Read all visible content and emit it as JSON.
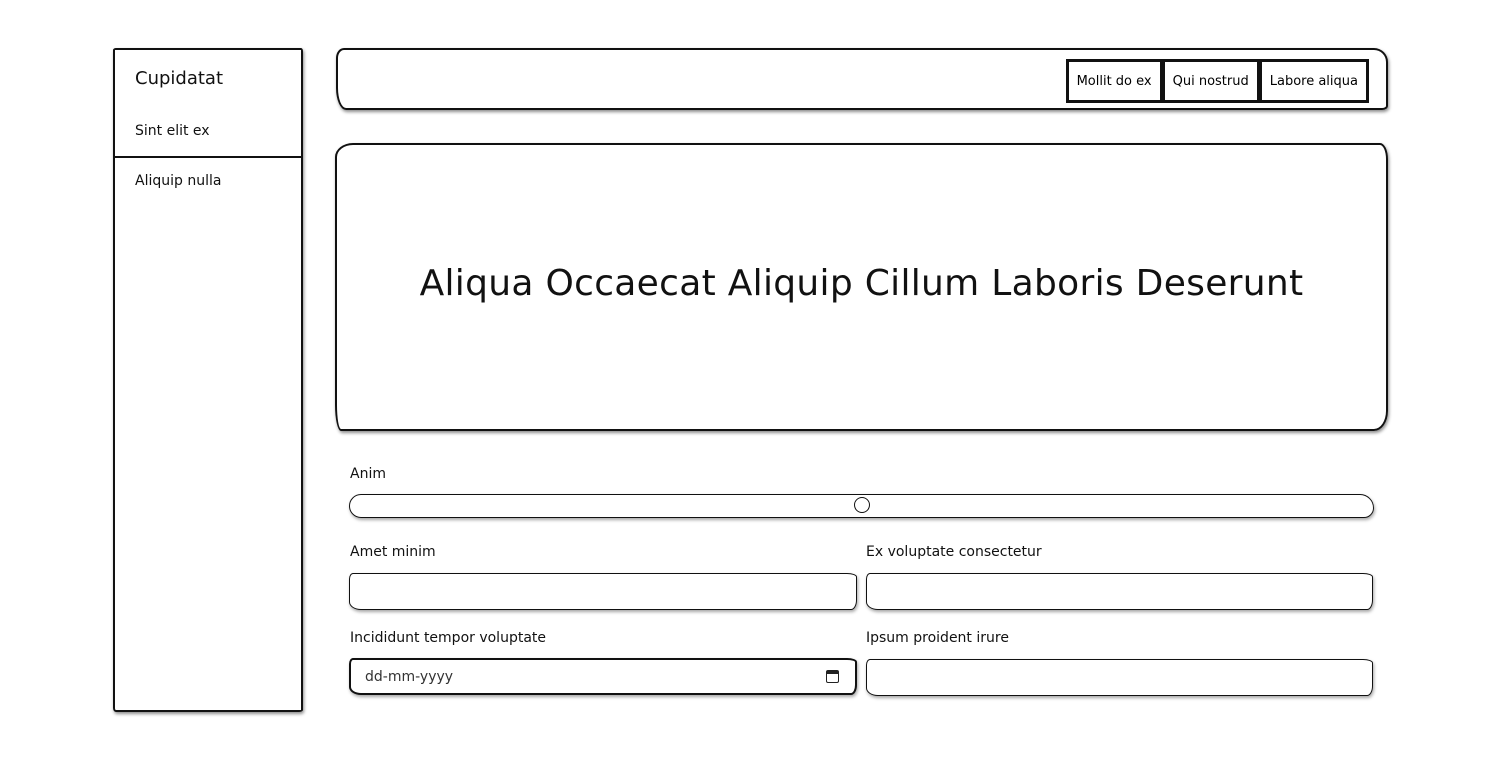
{
  "sidebar": {
    "title": "Cupidatat",
    "items": [
      {
        "label": "Sint elit ex"
      },
      {
        "label": "Aliquip nulla"
      }
    ]
  },
  "header": {
    "buttons": [
      {
        "label": "Mollit do ex"
      },
      {
        "label": "Qui nostrud"
      },
      {
        "label": "Labore aliqua"
      }
    ]
  },
  "hero": {
    "title": "Aliqua Occaecat Aliquip Cillum Laboris Deserunt"
  },
  "form": {
    "slider": {
      "label": "Anim",
      "value_percent": 50
    },
    "field_1": {
      "label": "Amet minim",
      "value": ""
    },
    "field_2": {
      "label": "Ex voluptate consectetur",
      "value": ""
    },
    "field_3": {
      "label": "Incididunt tempor voluptate",
      "placeholder": "dd-mm-yyyy",
      "icon": "calendar-icon"
    },
    "field_4": {
      "label": "Ipsum proident irure",
      "value": ""
    }
  }
}
